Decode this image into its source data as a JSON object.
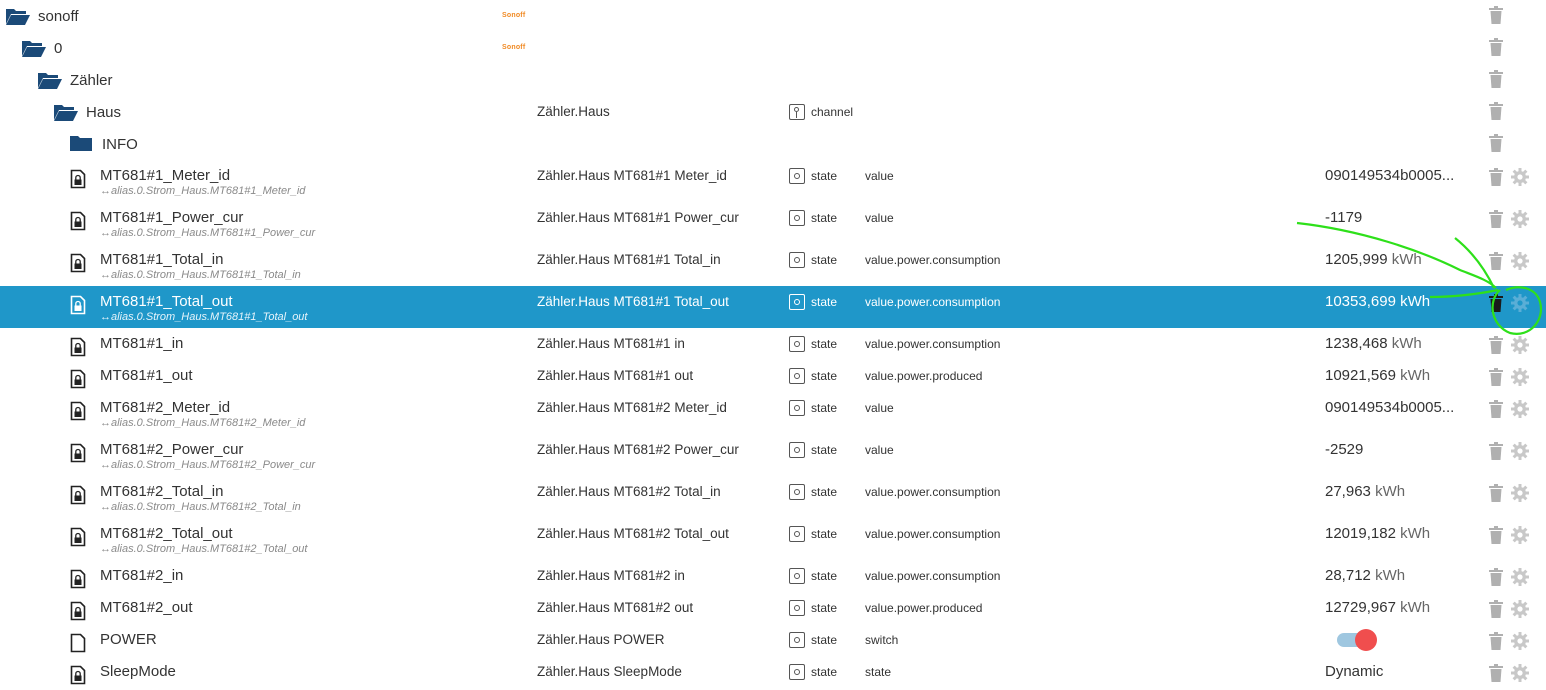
{
  "tree": {
    "folders": [
      {
        "label": "sonoff",
        "logo": "Sonoff"
      },
      {
        "label": "0",
        "logo": "Sonoff"
      },
      {
        "label": "Zähler"
      },
      {
        "label": "Haus",
        "name": "Zähler.Haus",
        "type": "channel"
      },
      {
        "label": "INFO"
      }
    ],
    "states": [
      {
        "label": "MT681#1_Meter_id",
        "alias": "↔alias.0.Strom_Haus.MT681#1_Meter_id",
        "name": "Zähler.Haus MT681#1 Meter_id",
        "type": "state",
        "role": "value",
        "value": "090149534b0005...",
        "unit": ""
      },
      {
        "label": "MT681#1_Power_cur",
        "alias": "↔alias.0.Strom_Haus.MT681#1_Power_cur",
        "name": "Zähler.Haus MT681#1 Power_cur",
        "type": "state",
        "role": "value",
        "value": "-1179",
        "unit": ""
      },
      {
        "label": "MT681#1_Total_in",
        "alias": "↔alias.0.Strom_Haus.MT681#1_Total_in",
        "name": "Zähler.Haus MT681#1 Total_in",
        "type": "state",
        "role": "value.power.consumption",
        "value": "1205,999",
        "unit": "kWh"
      },
      {
        "label": "MT681#1_Total_out",
        "alias": "↔alias.0.Strom_Haus.MT681#1_Total_out",
        "name": "Zähler.Haus MT681#1 Total_out",
        "type": "state",
        "role": "value.power.consumption",
        "value": "10353,699",
        "unit": "kWh",
        "selected": true
      },
      {
        "label": "MT681#1_in",
        "alias": "",
        "name": "Zähler.Haus MT681#1 in",
        "type": "state",
        "role": "value.power.consumption",
        "value": "1238,468",
        "unit": "kWh"
      },
      {
        "label": "MT681#1_out",
        "alias": "",
        "name": "Zähler.Haus MT681#1 out",
        "type": "state",
        "role": "value.power.produced",
        "value": "10921,569",
        "unit": "kWh"
      },
      {
        "label": "MT681#2_Meter_id",
        "alias": "↔alias.0.Strom_Haus.MT681#2_Meter_id",
        "name": "Zähler.Haus MT681#2 Meter_id",
        "type": "state",
        "role": "value",
        "value": "090149534b0005...",
        "unit": ""
      },
      {
        "label": "MT681#2_Power_cur",
        "alias": "↔alias.0.Strom_Haus.MT681#2_Power_cur",
        "name": "Zähler.Haus MT681#2 Power_cur",
        "type": "state",
        "role": "value",
        "value": "-2529",
        "unit": ""
      },
      {
        "label": "MT681#2_Total_in",
        "alias": "↔alias.0.Strom_Haus.MT681#2_Total_in",
        "name": "Zähler.Haus MT681#2 Total_in",
        "type": "state",
        "role": "value.power.consumption",
        "value": "27,963",
        "unit": "kWh"
      },
      {
        "label": "MT681#2_Total_out",
        "alias": "↔alias.0.Strom_Haus.MT681#2_Total_out",
        "name": "Zähler.Haus MT681#2 Total_out",
        "type": "state",
        "role": "value.power.consumption",
        "value": "12019,182",
        "unit": "kWh"
      },
      {
        "label": "MT681#2_in",
        "alias": "",
        "name": "Zähler.Haus MT681#2 in",
        "type": "state",
        "role": "value.power.consumption",
        "value": "28,712",
        "unit": "kWh"
      },
      {
        "label": "MT681#2_out",
        "alias": "",
        "name": "Zähler.Haus MT681#2 out",
        "type": "state",
        "role": "value.power.produced",
        "value": "12729,967",
        "unit": "kWh"
      },
      {
        "label": "POWER",
        "alias": "",
        "name": "Zähler.Haus POWER",
        "type": "state",
        "role": "switch",
        "value": "",
        "unit": "",
        "toggle": true,
        "toggle_on": true,
        "plainIcon": true
      },
      {
        "label": "SleepMode",
        "alias": "",
        "name": "Zähler.Haus SleepMode",
        "type": "state",
        "role": "state",
        "value": "Dynamic",
        "unit": ""
      }
    ]
  },
  "icons": {
    "folder": "folder-open-icon",
    "file": "file-lock-icon",
    "trash": "trash-icon",
    "settings": "gear-icon"
  },
  "colors": {
    "folder": "#1b4a78",
    "selected_row": "#1f97c9",
    "toggle_knob": "#f04e4e",
    "toggle_track": "#9fc7e0",
    "annotation": "#2ee01a",
    "brand_logo": "#f08a24"
  }
}
